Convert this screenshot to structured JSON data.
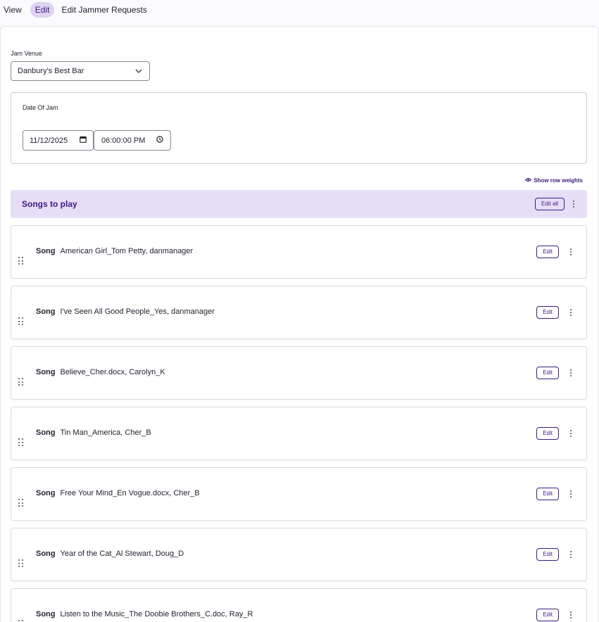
{
  "tabs": [
    {
      "label": "View",
      "active": false
    },
    {
      "label": "Edit",
      "active": true
    },
    {
      "label": "Edit Jammer Requests",
      "active": false
    }
  ],
  "form": {
    "venue_label": "Jam Venue",
    "venue_value": "Danbury's Best Bar",
    "date_label": "Date Of Jam",
    "date_value": "11/12/2025",
    "time_value": "06:00:00 PM"
  },
  "weights_label": "Show row weights",
  "group": {
    "title": "Songs to play",
    "edit_all_label": "Edit all"
  },
  "row_type_label": "Song",
  "row_edit_label": "Edit",
  "rows": [
    "American Girl_Tom Petty, danmanager",
    "I've Seen All Good People_Yes, danmanager",
    "Believe_Cher.docx, Carolyn_K",
    "Tin Man_America, Cher_B",
    "Free Your Mind_En Vogue.docx, Cher_B",
    "Year of the Cat_Al Stewart, Doug_D",
    "Listen to the Music_The Doobie Brothers_C.doc, Ray_R"
  ],
  "colors": {
    "accent": "#3b1b84",
    "header_bg": "#e6def6",
    "active_tab_bg": "#ddd3f2"
  }
}
